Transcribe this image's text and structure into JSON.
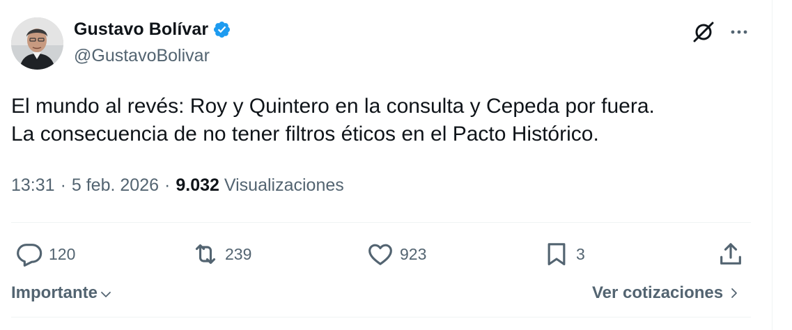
{
  "author": {
    "display_name": "Gustavo Bolívar",
    "handle": "@GustavoBolivar",
    "verified": true,
    "verified_color": "#1d9bf0"
  },
  "tweet": {
    "text": "El mundo al revés: Roy y Quintero en la consulta y Cepeda por fuera.\nLa consecuencia de no tener filtros éticos en el Pacto Histórico."
  },
  "meta": {
    "time": "13:31",
    "separator": "·",
    "date": "5 feb. 2026",
    "views_count": "9.032",
    "views_label": "Visualizaciones"
  },
  "actions": {
    "replies": "120",
    "reposts": "239",
    "likes": "923",
    "bookmarks": "3"
  },
  "footer": {
    "sort_label": "Importante",
    "quotes_label": "Ver cotizaciones"
  },
  "icons": {
    "top_right": [
      "grok-icon",
      "more-icon"
    ],
    "actions": [
      "reply-icon",
      "repost-icon",
      "like-icon",
      "bookmark-icon",
      "share-icon"
    ]
  },
  "colors": {
    "text_primary": "#0f1419",
    "text_secondary": "#536471",
    "divider": "#eff3f4"
  }
}
